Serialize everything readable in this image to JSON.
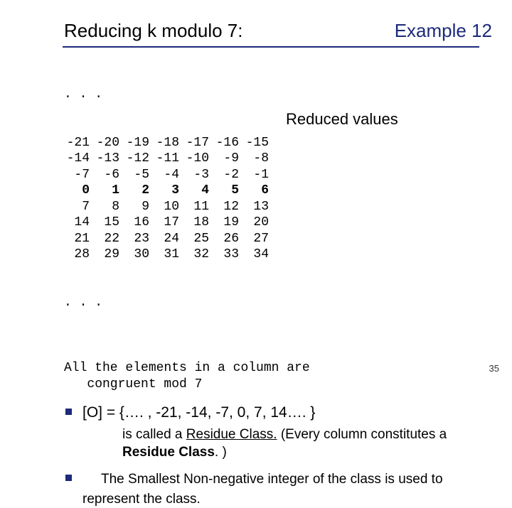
{
  "title": "Reducing k modulo 7:",
  "example_label": "Example 12",
  "ellipsis": ". . .",
  "table_rows": [
    [
      "-21",
      "-20",
      "-19",
      "-18",
      "-17",
      "-16",
      "-15"
    ],
    [
      "-14",
      "-13",
      "-12",
      "-11",
      "-10",
      "-9",
      "-8"
    ],
    [
      "-7",
      "-6",
      "-5",
      "-4",
      "-3",
      "-2",
      "-1"
    ],
    [
      "0",
      "1",
      "2",
      "3",
      "4",
      "5",
      "6"
    ],
    [
      "7",
      "8",
      "9",
      "10",
      "11",
      "12",
      "13"
    ],
    [
      "14",
      "15",
      "16",
      "17",
      "18",
      "19",
      "20"
    ],
    [
      "21",
      "22",
      "23",
      "24",
      "25",
      "26",
      "27"
    ],
    [
      "28",
      "29",
      "30",
      "31",
      "32",
      "33",
      "34"
    ]
  ],
  "bold_row_index": 3,
  "reduced_label": "Reduced values",
  "congruent_line": "All the elements in a column are\n   congruent mod 7",
  "bullet1": "[O] = {…. , -21, -14, -7, 0, 7, 14…. }",
  "sub1_a": "is called a  ",
  "sub1_b": "Residue Class.",
  "sub1_c": " (Every column constitutes a ",
  "sub1_d": "Residue Class",
  "sub1_e": ". )",
  "bullet2": "The Smallest Non-negative integer of the class is used to represent the class.",
  "page_number": "35"
}
